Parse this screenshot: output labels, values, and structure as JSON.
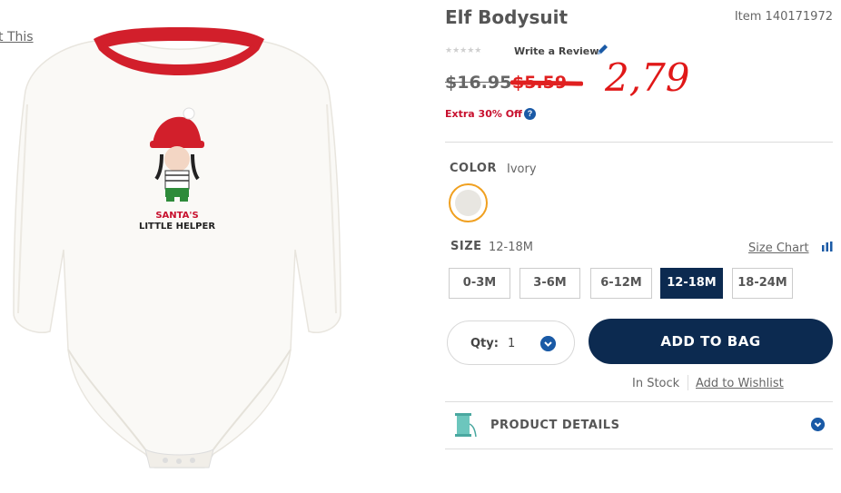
{
  "left": {
    "share_text": "t This"
  },
  "product": {
    "title": "Elf Bodysuit",
    "item_number": "Item 140171972",
    "rating_stars": "★★★★★",
    "write_review": "Write a Review",
    "original_price": "$16.95",
    "sale_price": "$5.59",
    "handwritten_price": "2,79",
    "extra_off": "Extra 30% Off",
    "help_glyph": "?"
  },
  "color": {
    "label": "COLOR",
    "value": "Ivory",
    "swatch_hex": "#e8e6e1"
  },
  "size": {
    "label": "SIZE",
    "value": "12-18M",
    "chart_link": "Size Chart",
    "options": [
      "0-3M",
      "3-6M",
      "6-12M",
      "12-18M",
      "18-24M"
    ],
    "selected": "12-18M"
  },
  "purchase": {
    "qty_label": "Qty:",
    "qty_value": "1",
    "add_to_bag": "ADD TO BAG",
    "stock_status": "In Stock",
    "wishlist": "Add to Wishlist"
  },
  "details": {
    "label": "PRODUCT DETAILS"
  },
  "image_print": {
    "line1": "SANTA'S",
    "line2": "LITTLE HELPER"
  },
  "colors": {
    "navy": "#0c2a50",
    "accent_blue": "#1a5aa6",
    "sale_red": "#e02020",
    "trim_red": "#c8102e"
  }
}
